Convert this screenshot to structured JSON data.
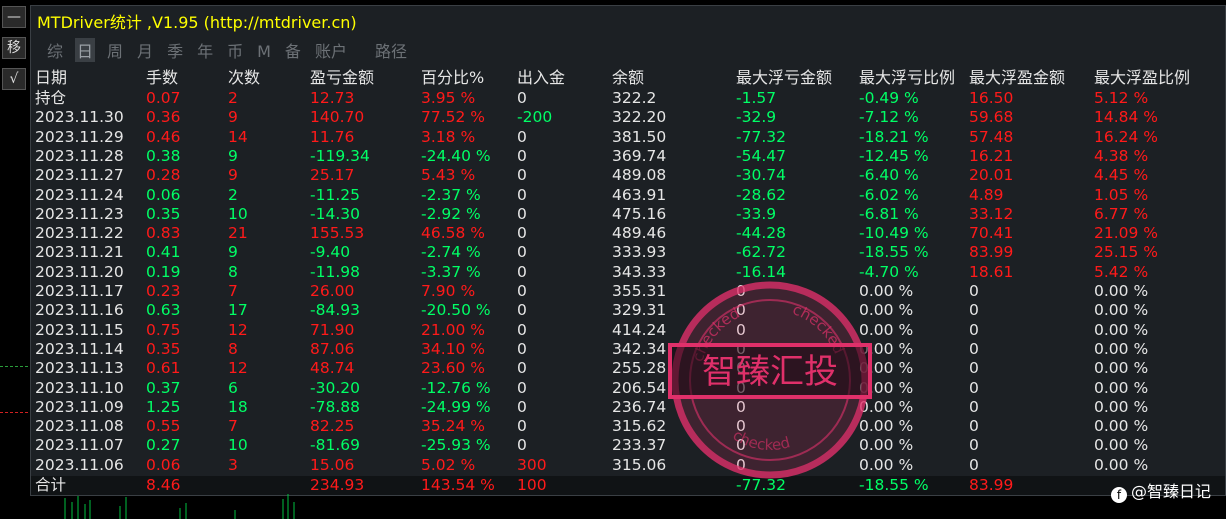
{
  "window": {
    "title": "MTDriver统计 ,V1.95 (http://mtdriver.cn)"
  },
  "toolbar": {
    "minimize_label": "—",
    "move_label": "移",
    "check_label": "√"
  },
  "tabs": [
    {
      "label": "综",
      "active": false
    },
    {
      "label": "日",
      "active": true
    },
    {
      "label": "周",
      "active": false
    },
    {
      "label": "月",
      "active": false
    },
    {
      "label": "季",
      "active": false
    },
    {
      "label": "年",
      "active": false
    },
    {
      "label": "币",
      "active": false
    },
    {
      "label": "M",
      "active": false
    },
    {
      "label": "备",
      "active": false
    },
    {
      "label": "账户",
      "active": false
    },
    {
      "label": "路径",
      "active": false
    }
  ],
  "columns": [
    "日期",
    "手数",
    "次数",
    "盈亏金额",
    "百分比%",
    "出入金",
    "余额",
    "最大浮亏金额",
    "最大浮亏比例",
    "最大浮盈金额",
    "最大浮盈比例"
  ],
  "rows": [
    [
      "持仓",
      "0.07",
      "2",
      "12.73",
      "3.95 %",
      "0",
      "322.2",
      "-1.57",
      "-0.49 %",
      "16.50",
      "5.12 %"
    ],
    [
      "2023.11.30",
      "0.36",
      "9",
      "140.70",
      "77.52 %",
      "-200",
      "322.20",
      "-32.9",
      "-7.12 %",
      "59.68",
      "14.84 %"
    ],
    [
      "2023.11.29",
      "0.46",
      "14",
      "11.76",
      "3.18 %",
      "0",
      "381.50",
      "-77.32",
      "-18.21 %",
      "57.48",
      "16.24 %"
    ],
    [
      "2023.11.28",
      "0.38",
      "9",
      "-119.34",
      "-24.40 %",
      "0",
      "369.74",
      "-54.47",
      "-12.45 %",
      "16.21",
      "4.38 %"
    ],
    [
      "2023.11.27",
      "0.28",
      "9",
      "25.17",
      "5.43 %",
      "0",
      "489.08",
      "-30.74",
      "-6.40 %",
      "20.01",
      "4.45 %"
    ],
    [
      "2023.11.24",
      "0.06",
      "2",
      "-11.25",
      "-2.37 %",
      "0",
      "463.91",
      "-28.62",
      "-6.02 %",
      "4.89",
      "1.05 %"
    ],
    [
      "2023.11.23",
      "0.35",
      "10",
      "-14.30",
      "-2.92 %",
      "0",
      "475.16",
      "-33.9",
      "-6.81 %",
      "33.12",
      "6.77 %"
    ],
    [
      "2023.11.22",
      "0.83",
      "21",
      "155.53",
      "46.58 %",
      "0",
      "489.46",
      "-44.28",
      "-10.49 %",
      "70.41",
      "21.09 %"
    ],
    [
      "2023.11.21",
      "0.41",
      "9",
      "-9.40",
      "-2.74 %",
      "0",
      "333.93",
      "-62.72",
      "-18.55 %",
      "83.99",
      "25.15 %"
    ],
    [
      "2023.11.20",
      "0.19",
      "8",
      "-11.98",
      "-3.37 %",
      "0",
      "343.33",
      "-16.14",
      "-4.70 %",
      "18.61",
      "5.42 %"
    ],
    [
      "2023.11.17",
      "0.23",
      "7",
      "26.00",
      "7.90 %",
      "0",
      "355.31",
      "0",
      "0.00 %",
      "0",
      "0.00 %"
    ],
    [
      "2023.11.16",
      "0.63",
      "17",
      "-84.93",
      "-20.50 %",
      "0",
      "329.31",
      "0",
      "0.00 %",
      "0",
      "0.00 %"
    ],
    [
      "2023.11.15",
      "0.75",
      "12",
      "71.90",
      "21.00 %",
      "0",
      "414.24",
      "0",
      "0.00 %",
      "0",
      "0.00 %"
    ],
    [
      "2023.11.14",
      "0.35",
      "8",
      "87.06",
      "34.10 %",
      "0",
      "342.34",
      "0",
      "0.00 %",
      "0",
      "0.00 %"
    ],
    [
      "2023.11.13",
      "0.61",
      "12",
      "48.74",
      "23.60 %",
      "0",
      "255.28",
      "0",
      "0.00 %",
      "0",
      "0.00 %"
    ],
    [
      "2023.11.10",
      "0.37",
      "6",
      "-30.20",
      "-12.76 %",
      "0",
      "206.54",
      "0",
      "0.00 %",
      "0",
      "0.00 %"
    ],
    [
      "2023.11.09",
      "1.25",
      "18",
      "-78.88",
      "-24.99 %",
      "0",
      "236.74",
      "0",
      "0.00 %",
      "0",
      "0.00 %"
    ],
    [
      "2023.11.08",
      "0.55",
      "7",
      "82.25",
      "35.24 %",
      "0",
      "315.62",
      "0",
      "0.00 %",
      "0",
      "0.00 %"
    ],
    [
      "2023.11.07",
      "0.27",
      "10",
      "-81.69",
      "-25.93 %",
      "0",
      "233.37",
      "0",
      "0.00 %",
      "0",
      "0.00 %"
    ],
    [
      "2023.11.06",
      "0.06",
      "3",
      "15.06",
      "5.02 %",
      "300",
      "315.06",
      "0",
      "0.00 %",
      "0",
      "0.00 %"
    ]
  ],
  "row_colors": [
    [
      "white",
      "red",
      "red",
      "red",
      "red",
      "white",
      "white",
      "green",
      "green",
      "red",
      "red"
    ],
    [
      "white",
      "red",
      "red",
      "red",
      "red",
      "green",
      "white",
      "green",
      "green",
      "red",
      "red"
    ],
    [
      "white",
      "red",
      "red",
      "red",
      "red",
      "white",
      "white",
      "green",
      "green",
      "red",
      "red"
    ],
    [
      "white",
      "green",
      "green",
      "green",
      "green",
      "white",
      "white",
      "green",
      "green",
      "red",
      "red"
    ],
    [
      "white",
      "red",
      "red",
      "red",
      "red",
      "white",
      "white",
      "green",
      "green",
      "red",
      "red"
    ],
    [
      "white",
      "green",
      "green",
      "green",
      "green",
      "white",
      "white",
      "green",
      "green",
      "red",
      "red"
    ],
    [
      "white",
      "green",
      "green",
      "green",
      "green",
      "white",
      "white",
      "green",
      "green",
      "red",
      "red"
    ],
    [
      "white",
      "red",
      "red",
      "red",
      "red",
      "white",
      "white",
      "green",
      "green",
      "red",
      "red"
    ],
    [
      "white",
      "green",
      "green",
      "green",
      "green",
      "white",
      "white",
      "green",
      "green",
      "red",
      "red"
    ],
    [
      "white",
      "green",
      "green",
      "green",
      "green",
      "white",
      "white",
      "green",
      "green",
      "red",
      "red"
    ],
    [
      "white",
      "red",
      "red",
      "red",
      "red",
      "white",
      "white",
      "white",
      "white",
      "white",
      "white"
    ],
    [
      "white",
      "green",
      "green",
      "green",
      "green",
      "white",
      "white",
      "white",
      "white",
      "white",
      "white"
    ],
    [
      "white",
      "red",
      "red",
      "red",
      "red",
      "white",
      "white",
      "white",
      "white",
      "white",
      "white"
    ],
    [
      "white",
      "red",
      "red",
      "red",
      "red",
      "white",
      "white",
      "white",
      "white",
      "white",
      "white"
    ],
    [
      "white",
      "red",
      "red",
      "red",
      "red",
      "white",
      "white",
      "white",
      "white",
      "white",
      "white"
    ],
    [
      "white",
      "green",
      "green",
      "green",
      "green",
      "white",
      "white",
      "white",
      "white",
      "white",
      "white"
    ],
    [
      "white",
      "green",
      "green",
      "green",
      "green",
      "white",
      "white",
      "white",
      "white",
      "white",
      "white"
    ],
    [
      "white",
      "red",
      "red",
      "red",
      "red",
      "white",
      "white",
      "white",
      "white",
      "white",
      "white"
    ],
    [
      "white",
      "green",
      "green",
      "green",
      "green",
      "white",
      "white",
      "white",
      "white",
      "white",
      "white"
    ],
    [
      "white",
      "red",
      "red",
      "red",
      "red",
      "red",
      "white",
      "white",
      "white",
      "white",
      "white"
    ]
  ],
  "summary": {
    "label": "合计",
    "lots": "8.46",
    "profit": "234.93",
    "percent": "143.54 %",
    "deposit": "100",
    "max_float_loss": "-77.32",
    "max_float_loss_pct": "-18.55 %",
    "max_float_profit": "83.99"
  },
  "stamp": {
    "center_text": "智臻汇投",
    "ring_text": "checked"
  },
  "footer": {
    "brand": "@智臻日记"
  },
  "colors": {
    "profit": "#ff1a1a",
    "loss": "#00ff66",
    "title": "#ffff00",
    "stamp": "#e0306a"
  }
}
